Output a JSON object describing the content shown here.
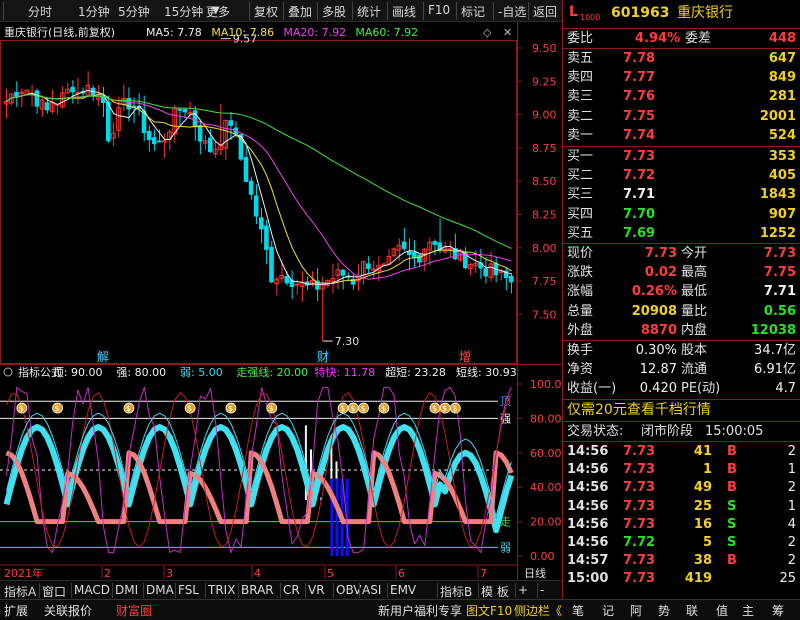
{
  "topbar": {
    "left": [
      "分时",
      "1分钟",
      "5分钟",
      "15分钟",
      "更多"
    ],
    "right": [
      "复权",
      "叠加",
      "多股",
      "统计",
      "画线",
      "F10",
      "标记",
      "-自选",
      "返回"
    ]
  },
  "main": {
    "ma_legend": [
      {
        "text": "重庆银行(日线,前复权)",
        "color": "#e8e8e8"
      },
      {
        "text": "MA5: 7.78",
        "color": "#f0f0f0"
      },
      {
        "text": "MA10: 7.86",
        "color": "#f0e040"
      },
      {
        "text": "MA20: 7.92",
        "color": "#f040f0"
      },
      {
        "text": "MA60: 7.92",
        "color": "#40f040"
      }
    ],
    "y_ticks": [
      "9.50",
      "9.25",
      "9.00",
      "8.75",
      "8.50",
      "8.25",
      "8.00",
      "7.75",
      "7.50"
    ],
    "high_label": "9.57",
    "low_label": "7.30",
    "markers": [
      {
        "text": "解",
        "color": "#40c8ff"
      },
      {
        "text": "财",
        "color": "#40c8ff"
      },
      {
        "text": "增",
        "color": "#ff4040"
      }
    ]
  },
  "indicator": {
    "legend": [
      {
        "text": "指标公式",
        "color": "#e8e8e8"
      },
      {
        "text": "顶: 90.00",
        "color": "#f0f0f0"
      },
      {
        "text": "强: 80.00",
        "color": "#f0f0f0"
      },
      {
        "text": "弱: 5.00",
        "color": "#40d8f0"
      },
      {
        "text": "走强线: 20.00",
        "color": "#40f040"
      },
      {
        "text": "特快: 11.78",
        "color": "#f040f0"
      },
      {
        "text": "超短: 23.28",
        "color": "#f0f0f0"
      },
      {
        "text": "短线: 30.93",
        "color": "#f0f0f0"
      }
    ],
    "y_ticks": [
      "100.00",
      "80.00",
      "60.00",
      "40.00",
      "20.00",
      "0.00"
    ],
    "labels": {
      "ding": "顶",
      "qiang": "强",
      "zou": "走",
      "ruo": "弱"
    }
  },
  "timeline": {
    "year": "2021年",
    "months": [
      "2",
      "3",
      "4",
      "5",
      "6",
      "7"
    ],
    "right": "日线"
  },
  "tabs": [
    "指标A",
    "窗口",
    "MACD",
    "DMI",
    "DMA",
    "FSL",
    "TRIX",
    "BRAR",
    "CR",
    "VR",
    "OBV",
    "ASI",
    "EMV",
    "指标B",
    "模 板",
    "+",
    "-"
  ],
  "botbar": {
    "left": [
      "扩展",
      "关联报价",
      "财富圈"
    ],
    "mid": "新用户福利专享",
    "right_items": [
      "图文F10",
      "侧边栏《",
      "笔",
      "记",
      "阿",
      "势",
      "联",
      "值",
      "主",
      "筹"
    ]
  },
  "quote": {
    "code": "601963",
    "name": "重庆银行",
    "badge": "L",
    "badge2": "1000",
    "weibi_label": "委比",
    "weibi": "4.94%",
    "weicha_label": "委差",
    "weicha": "448",
    "asks": [
      {
        "label": "卖五",
        "price": "7.78",
        "vol": "647"
      },
      {
        "label": "卖四",
        "price": "7.77",
        "vol": "849"
      },
      {
        "label": "卖三",
        "price": "7.76",
        "vol": "281"
      },
      {
        "label": "卖二",
        "price": "7.75",
        "vol": "2001"
      },
      {
        "label": "卖一",
        "price": "7.74",
        "vol": "524"
      }
    ],
    "bids": [
      {
        "label": "买一",
        "price": "7.73",
        "vol": "353"
      },
      {
        "label": "买二",
        "price": "7.72",
        "vol": "405"
      },
      {
        "label": "买三",
        "price": "7.71",
        "vol": "1843"
      },
      {
        "label": "买四",
        "price": "7.70",
        "vol": "907"
      },
      {
        "label": "买五",
        "price": "7.69",
        "vol": "1252"
      }
    ],
    "stats": [
      {
        "l": "现价",
        "v": "7.73",
        "l2": "今开",
        "v2": "7.73"
      },
      {
        "l": "涨跌",
        "v": "0.02",
        "l2": "最高",
        "v2": "7.75"
      },
      {
        "l": "涨幅",
        "v": "0.26%",
        "l2": "最低",
        "v2": "7.71"
      },
      {
        "l": "总量",
        "v": "20908",
        "l2": "量比",
        "v2": "0.56"
      },
      {
        "l": "外盘",
        "v": "8870",
        "l2": "内盘",
        "v2": "12038"
      }
    ],
    "stats2": [
      {
        "l": "换手",
        "v": "0.30%",
        "l2": "股本",
        "v2": "34.7亿"
      },
      {
        "l": "净资",
        "v": "12.87",
        "l2": "流通",
        "v2": "6.91亿"
      },
      {
        "l": "收益(一)",
        "v": "0.420",
        "l2": "PE(动)",
        "v2": "4.7"
      }
    ],
    "promo": "仅需20元查看千档行情",
    "status_label": "交易状态:",
    "status": "闭市阶段",
    "status_time": "15:00:05",
    "ticks": [
      {
        "t": "14:56",
        "p": "7.73",
        "v": "41",
        "s": "B",
        "n": "2"
      },
      {
        "t": "14:56",
        "p": "7.73",
        "v": "1",
        "s": "B",
        "n": "1"
      },
      {
        "t": "14:56",
        "p": "7.73",
        "v": "49",
        "s": "B",
        "n": "2"
      },
      {
        "t": "14:56",
        "p": "7.73",
        "v": "25",
        "s": "S",
        "n": "1"
      },
      {
        "t": "14:56",
        "p": "7.73",
        "v": "16",
        "s": "S",
        "n": "4"
      },
      {
        "t": "14:56",
        "p": "7.72",
        "v": "5",
        "s": "S",
        "n": "2"
      },
      {
        "t": "14:57",
        "p": "7.73",
        "v": "38",
        "s": "B",
        "n": "2"
      },
      {
        "t": "15:00",
        "p": "7.73",
        "v": "419",
        "s": "",
        "n": "25"
      }
    ]
  },
  "colors": {
    "up": "#ff3232",
    "down": "#00d8e8",
    "ma5": "#f0f0f0",
    "ma10": "#f0e040",
    "ma20": "#f040f0",
    "ma60": "#40e040",
    "frame": "#8b1a1a"
  }
}
